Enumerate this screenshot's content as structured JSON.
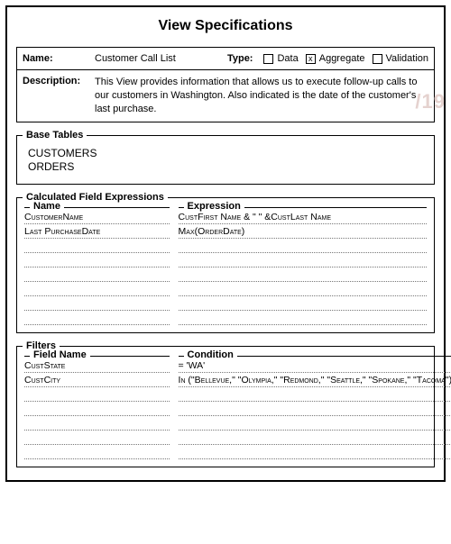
{
  "title": "View Specifications",
  "meta": {
    "name_label": "Name:",
    "name_value": "Customer Call List",
    "type_label": "Type:",
    "type_options": {
      "data": {
        "label": "Data",
        "checked": false
      },
      "aggregate": {
        "label": "Aggregate",
        "checked": true
      },
      "validation": {
        "label": "Validation",
        "checked": false
      }
    },
    "desc_label": "Description:",
    "desc_value": "This View provides information that allows us to execute follow-up calls to our customers in Washington. Also indicated is the date of the customer's last purchase."
  },
  "base_tables": {
    "legend": "Base Tables",
    "items": [
      "CUSTOMERS",
      "ORDERS"
    ]
  },
  "calc": {
    "legend": "Calculated Field Expressions",
    "name_header": "Name",
    "expr_header": "Expression",
    "rows": [
      {
        "name": "CustomerName",
        "expr": "CustFirst Name & \" \" &CustLast Name"
      },
      {
        "name": "Last PurchaseDate",
        "expr": "Max(OrderDate)"
      },
      {
        "name": "",
        "expr": ""
      },
      {
        "name": "",
        "expr": ""
      },
      {
        "name": "",
        "expr": ""
      },
      {
        "name": "",
        "expr": ""
      },
      {
        "name": "",
        "expr": ""
      },
      {
        "name": "",
        "expr": ""
      }
    ]
  },
  "filters": {
    "legend": "Filters",
    "name_header": "Field Name",
    "cond_header": "Condition",
    "rows": [
      {
        "name": "CustState",
        "cond": "= 'WA'"
      },
      {
        "name": "CustCity",
        "cond": "In (\"Bellevue,\" \"Olympia,\" \"Redmond,\" \"Seattle,\" \"Spokane,\" \"Tacoma\")"
      },
      {
        "name": "",
        "cond": ""
      },
      {
        "name": "",
        "cond": ""
      },
      {
        "name": "",
        "cond": ""
      },
      {
        "name": "",
        "cond": ""
      },
      {
        "name": "",
        "cond": ""
      }
    ]
  },
  "watermark": "/19"
}
